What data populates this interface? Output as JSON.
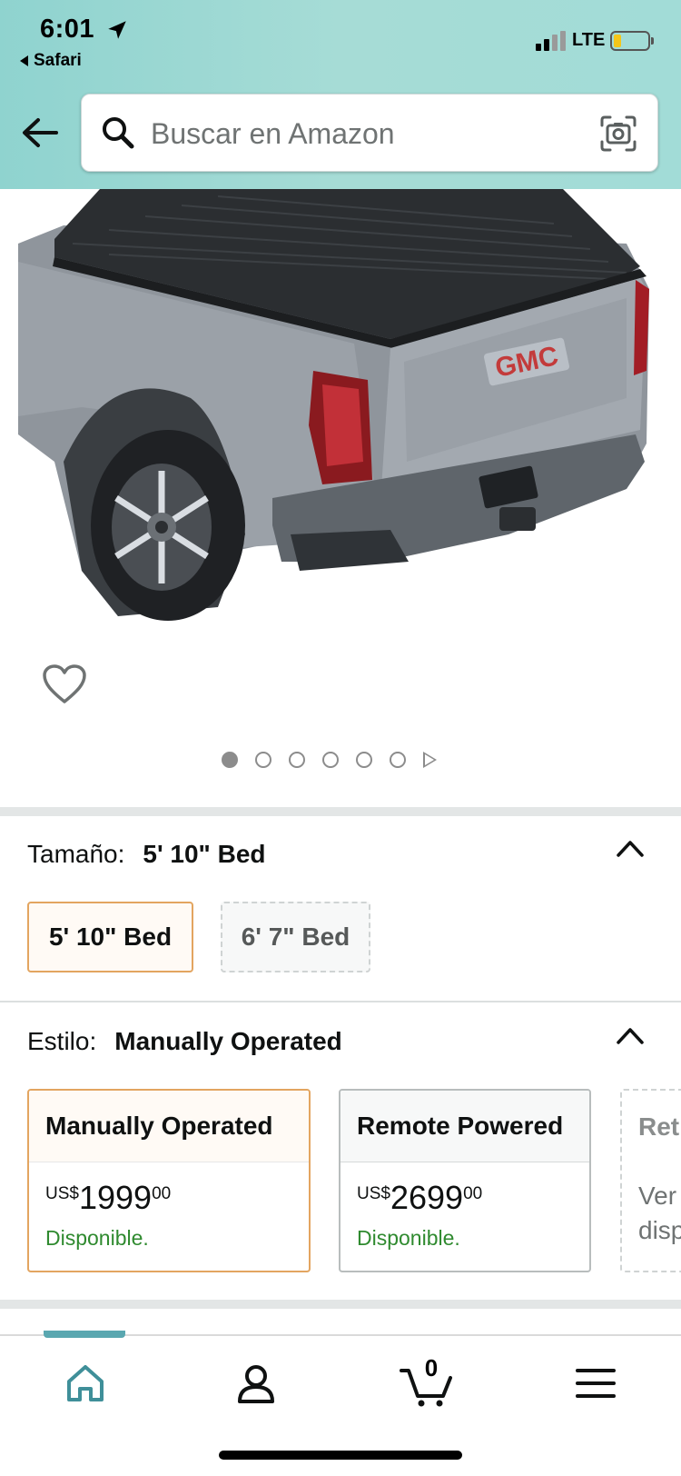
{
  "status_bar": {
    "time": "6:01",
    "back_app": "Safari",
    "network": "LTE"
  },
  "search": {
    "placeholder": "Buscar en Amazon"
  },
  "gallery": {
    "image_count": 6,
    "active_index": 0
  },
  "size_selector": {
    "label": "Tamaño:",
    "selected_value": "5' 10\" Bed",
    "options": [
      {
        "label": "5' 10\" Bed",
        "selected": true,
        "available": true
      },
      {
        "label": "6' 7\" Bed",
        "selected": false,
        "available": false
      }
    ]
  },
  "style_selector": {
    "label": "Estilo:",
    "selected_value": "Manually Operated",
    "options": [
      {
        "title": "Manually Operated",
        "currency": "US$",
        "price_whole": "1999",
        "price_fraction": "00",
        "availability": "Disponible.",
        "selected": true
      },
      {
        "title": "Remote Powered",
        "currency": "US$",
        "price_whole": "2699",
        "price_fraction": "00",
        "availability": "Disponible.",
        "selected": false
      },
      {
        "title": "Ret",
        "line1": "Ver",
        "line2": "disp",
        "selected": false
      }
    ]
  },
  "bottom_nav": {
    "cart_count": "0",
    "items": [
      "home-icon",
      "account-icon",
      "cart-icon",
      "menu-icon"
    ]
  },
  "colors": {
    "accent_teal": "#5aa7b0",
    "selected_border": "#e3a560",
    "available_green": "#2f8a2f"
  }
}
